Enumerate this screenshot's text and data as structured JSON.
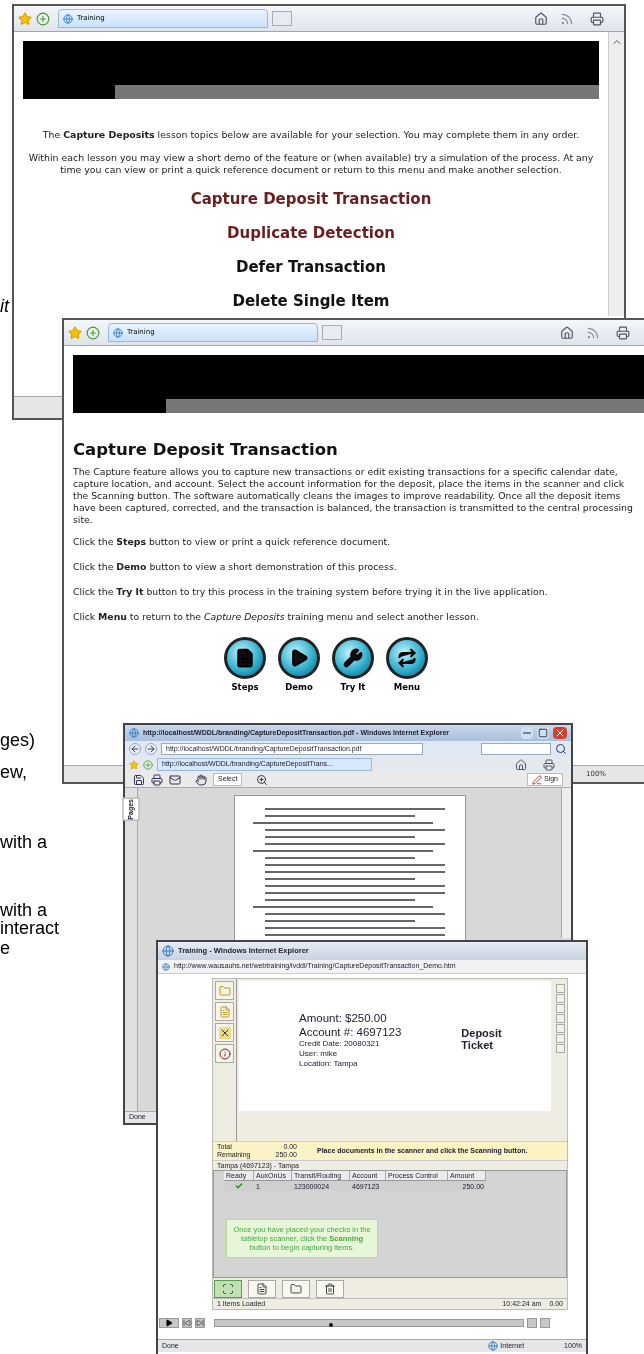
{
  "document_fragments": [
    {
      "text": "it",
      "italic": true
    },
    {
      "text": "ges)",
      "italic": false
    },
    {
      "text": "ew,",
      "italic": false
    },
    {
      "text": "with a",
      "italic": false
    },
    {
      "text": "with a",
      "italic": false
    },
    {
      "text": "interact",
      "italic": false
    },
    {
      "text": "e",
      "italic": false
    }
  ],
  "lesson_menu_window": {
    "tab": "Training",
    "intro": "The **Capture Deposits** lesson topics below are available for your selection. You may complete them in any order.",
    "instructions": "Within each lesson you may view a short demo of the feature or (when available) try a simulation of the process. At any time you can view or print a quick reference document or return to this menu and make another selection.",
    "lessons": [
      {
        "label": "Capture Deposit Transaction",
        "visited": true
      },
      {
        "label": "Duplicate Detection",
        "visited": true
      },
      {
        "label": "Defer Transaction",
        "visited": false
      },
      {
        "label": "Delete Single Item",
        "visited": false
      }
    ]
  },
  "lesson_window": {
    "tab": "Training",
    "heading": "Capture Deposit Transaction",
    "description": "The Capture feature allows you to capture new transactions or edit existing transactions for a specific calendar date, capture location, and account. Select the account information for the deposit, place the items in the scanner and click the Scanning button. The software automatically cleans the images to improve readability. Once all the deposit items have been captured, corrected, and the transaction is balanced, the transaction is transmitted to the central processing site.",
    "instructions": [
      "Click the **Steps** button to view or print a quick reference document.",
      "Click the **Demo** button to view a short demonstration of this process.",
      "Click the **Try It** button to try this process in the training system before trying it in the live application.",
      "Click **Menu** to return to the *Capture Deposits* training menu and select another lesson."
    ],
    "buttons": [
      {
        "kind": "steps",
        "label": "Steps"
      },
      {
        "kind": "demo",
        "label": "Demo"
      },
      {
        "kind": "try",
        "label": "Try It"
      },
      {
        "kind": "menu",
        "label": "Menu"
      }
    ],
    "zoom": "100%"
  },
  "pdf_window": {
    "title": "http://localhost/WDDL/branding/CaptureDepositTransaction.pdf - Windows Internet Explorer",
    "address": "http://localhost/WDDL/branding/CaptureDepositTransaction.pdf",
    "tab": "http://localhost/WDDL/branding/CaptureDepositTrans...",
    "select": "Select",
    "sign": "Sign",
    "side_tab": "Pages",
    "status": "Done"
  },
  "demo_window": {
    "title": "Training - Windows Internet Explorer",
    "address": "http://www.wausauhs.net/webtraining/ivddl/Training/CaptureDepositTransaction_Demo.htm",
    "ticket": {
      "fields": [
        {
          "label": "Amount:",
          "value": "$250.00",
          "large": true
        },
        {
          "label": "Account #:",
          "value": "4697123",
          "large": true
        },
        {
          "label": "Credit Date:",
          "value": "20080321",
          "large": false
        },
        {
          "label": "User:",
          "value": "mike",
          "large": false
        },
        {
          "label": "Location:",
          "value": "Tampa",
          "large": false
        }
      ],
      "title": "Deposit Ticket"
    },
    "totals": [
      {
        "label": "Total",
        "value": "0.00"
      },
      {
        "label": "Remaining",
        "value": "250.00"
      }
    ],
    "message": "Place documents in the scanner and click the Scanning button.",
    "grid": {
      "caption": "Tampa (4697123) - Tampa",
      "columns": [
        "Ready",
        "AuxOnUs",
        "Transit/Routing",
        "Account",
        "Process Control",
        "Amount"
      ],
      "rows": [
        {
          "ready": true,
          "aux_on_us": "1",
          "transit_routing": "123000024",
          "account": "4697123",
          "amount": "250.00"
        }
      ]
    },
    "callout": "Once you have placed your checks in the tabletop scanner, click the **Scanning** button to begin capturing items.",
    "status": {
      "left": "1 Items Loaded",
      "time": "10:42:24 am",
      "value": "0.00"
    },
    "playback": {
      "level": 0.37
    },
    "browser_status": "Done",
    "zone": "Internet",
    "zoom": "100%"
  }
}
